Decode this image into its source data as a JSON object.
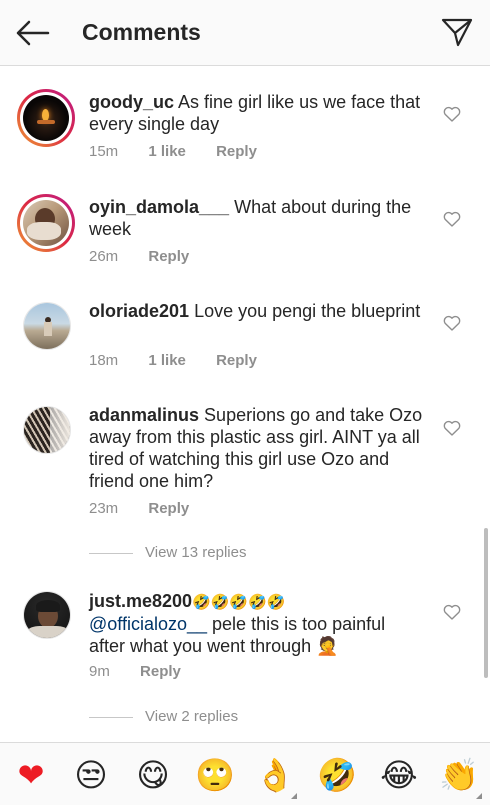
{
  "header": {
    "title": "Comments"
  },
  "comments": [
    {
      "username": "goody_uc",
      "text": "As  fine girl like us we face that every single day",
      "time": "15m",
      "likes": "1 like",
      "reply": "Reply"
    },
    {
      "username": "oyin_damola___",
      "text": "What about during the week",
      "time": "26m",
      "reply": "Reply"
    },
    {
      "username": "oloriade201",
      "text": "Love you pengi the blueprint",
      "time": "18m",
      "likes": "1 like",
      "reply": "Reply"
    },
    {
      "username": "adanmalinus",
      "text": "Superions go and take Ozo away from this plastic ass girl. AINT ya all tired of watching this girl use Ozo and friend one him?",
      "time": "23m",
      "reply": "Reply",
      "view_replies": "View 13 replies"
    },
    {
      "username": "just.me8200",
      "emojis": "🤣🤣🤣🤣🤣",
      "mention": "@officialozo__",
      "text": "pele this is too painful after what you went through 🤦",
      "time": "9m",
      "reply": "Reply",
      "view_replies": "View 2 replies"
    }
  ],
  "emoji_bar": [
    "❤",
    "😒",
    "😋",
    "🙄",
    "👌",
    "🤣",
    "😂",
    "👏"
  ],
  "colors": {
    "heart_red": "#ed1c24",
    "link": "#003569",
    "muted": "#8e8e8e"
  }
}
